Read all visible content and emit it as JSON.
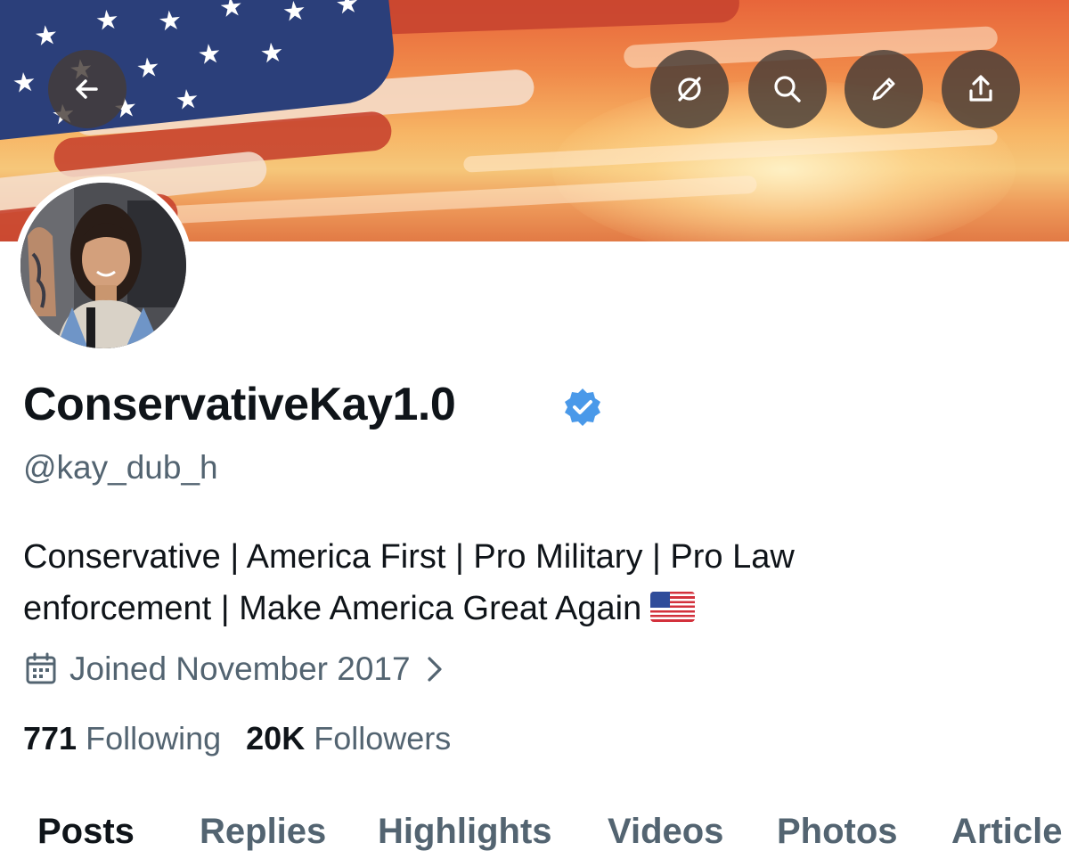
{
  "profile": {
    "display_name": "ConservativeKay1.0",
    "handle": "@kay_dub_h",
    "bio_line1": "Conservative | America First | Pro Military | Pro Law",
    "bio_line2": "enforcement | Make America Great Again",
    "bio_emoji": "us-flag-emoji",
    "joined": "Joined November 2017",
    "following_count": "771",
    "following_label": "Following",
    "followers_count": "20K",
    "followers_label": "Followers",
    "verified": true
  },
  "header_buttons": {
    "back": "back-arrow-icon",
    "actions": [
      "no-grok-icon",
      "search-icon",
      "edit-icon",
      "share-icon"
    ]
  },
  "tabs": [
    {
      "label": "Posts",
      "active": true
    },
    {
      "label": "Replies",
      "active": false
    },
    {
      "label": "Highlights",
      "active": false
    },
    {
      "label": "Videos",
      "active": false
    },
    {
      "label": "Photos",
      "active": false
    },
    {
      "label": "Article",
      "active": false
    }
  ],
  "colors": {
    "text_primary": "#0f1419",
    "text_secondary": "#536471",
    "verified_blue": "#4a99e9",
    "button_bg": "#463c37"
  }
}
